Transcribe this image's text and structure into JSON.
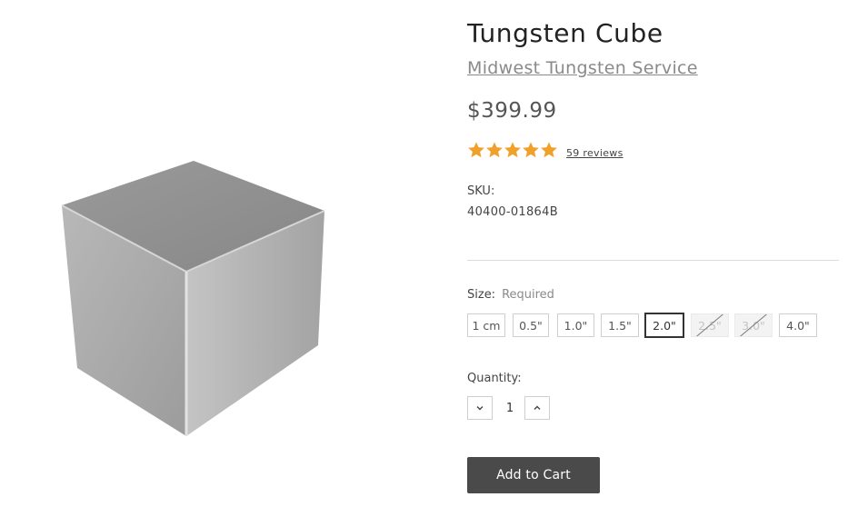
{
  "product": {
    "title": "Tungsten Cube",
    "brand": "Midwest Tungsten Service",
    "price": "$399.99",
    "rating": {
      "stars": 5,
      "max_stars": 5,
      "reviews_label": "59 reviews",
      "star_color": "#f0a12c"
    },
    "sku": {
      "label": "SKU:",
      "value": "40400-01864B"
    },
    "image_icon": "tungsten-cube-photo"
  },
  "size": {
    "label": "Size:",
    "required": "Required",
    "options": [
      {
        "label": "1 cm",
        "state": "available"
      },
      {
        "label": "0.5\"",
        "state": "available"
      },
      {
        "label": "1.0\"",
        "state": "available"
      },
      {
        "label": "1.5\"",
        "state": "available"
      },
      {
        "label": "2.0\"",
        "state": "selected"
      },
      {
        "label": "2.5\"",
        "state": "unavailable"
      },
      {
        "label": "3.0\"",
        "state": "unavailable"
      },
      {
        "label": "4.0\"",
        "state": "available"
      }
    ]
  },
  "quantity": {
    "label": "Quantity:",
    "value": "1",
    "decrease_icon": "chevron-down-icon",
    "increase_icon": "chevron-up-icon"
  },
  "cart": {
    "label": "Add to Cart"
  }
}
